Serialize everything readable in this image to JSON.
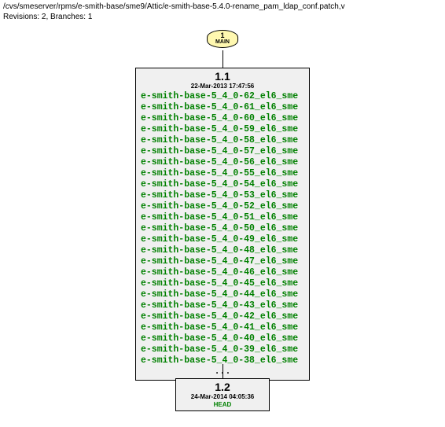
{
  "header": {
    "path": "/cvs/smeserver/rpms/e-smith-base/sme9/Attic/e-smith-base-5.4.0-rename_pam_ldap_conf.patch,v",
    "revisions": "Revisions: 2, Branches: 1"
  },
  "branch": {
    "num": "1",
    "name": "MAIN"
  },
  "rev_main": {
    "num": "1.1",
    "date": "22-Mar-2013 17:47:56",
    "tags": [
      "e-smith-base-5_4_0-62_el6_sme",
      "e-smith-base-5_4_0-61_el6_sme",
      "e-smith-base-5_4_0-60_el6_sme",
      "e-smith-base-5_4_0-59_el6_sme",
      "e-smith-base-5_4_0-58_el6_sme",
      "e-smith-base-5_4_0-57_el6_sme",
      "e-smith-base-5_4_0-56_el6_sme",
      "e-smith-base-5_4_0-55_el6_sme",
      "e-smith-base-5_4_0-54_el6_sme",
      "e-smith-base-5_4_0-53_el6_sme",
      "e-smith-base-5_4_0-52_el6_sme",
      "e-smith-base-5_4_0-51_el6_sme",
      "e-smith-base-5_4_0-50_el6_sme",
      "e-smith-base-5_4_0-49_el6_sme",
      "e-smith-base-5_4_0-48_el6_sme",
      "e-smith-base-5_4_0-47_el6_sme",
      "e-smith-base-5_4_0-46_el6_sme",
      "e-smith-base-5_4_0-45_el6_sme",
      "e-smith-base-5_4_0-44_el6_sme",
      "e-smith-base-5_4_0-43_el6_sme",
      "e-smith-base-5_4_0-42_el6_sme",
      "e-smith-base-5_4_0-41_el6_sme",
      "e-smith-base-5_4_0-40_el6_sme",
      "e-smith-base-5_4_0-39_el6_sme",
      "e-smith-base-5_4_0-38_el6_sme"
    ],
    "ellipsis": "..."
  },
  "rev_head": {
    "num": "1.2",
    "date": "24-Mar-2014 04:05:36",
    "label": "HEAD"
  }
}
